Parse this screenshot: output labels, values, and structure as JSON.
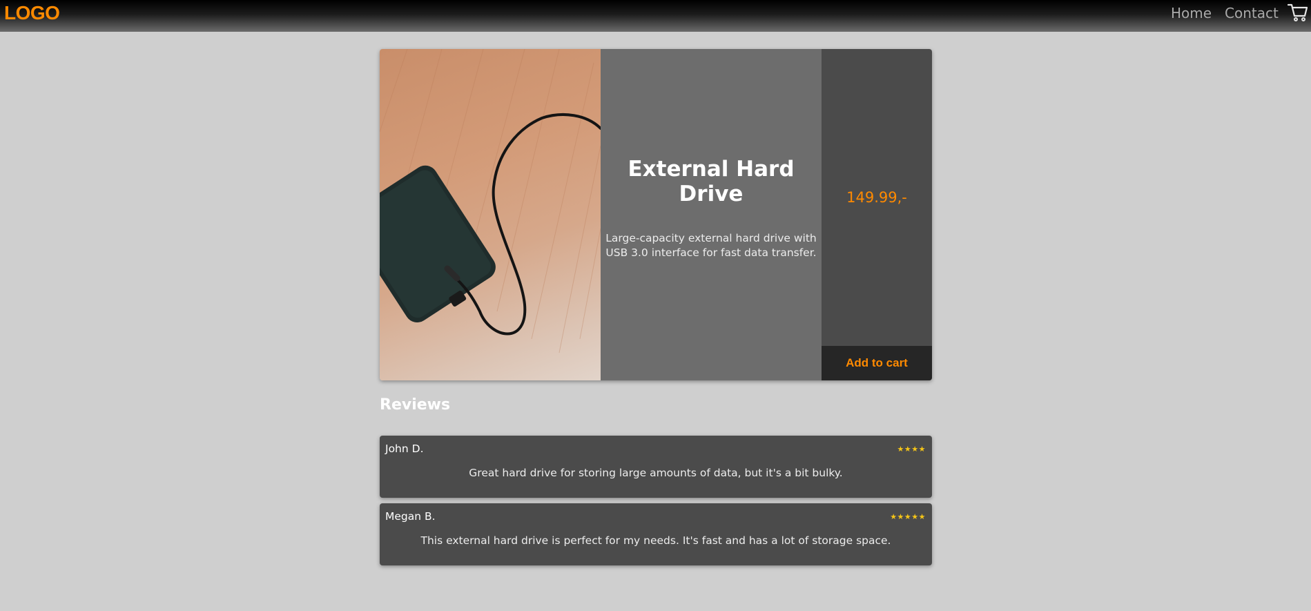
{
  "header": {
    "logo": "LOGO",
    "nav": [
      {
        "label": "Home"
      },
      {
        "label": "Contact"
      }
    ],
    "cart_icon": "shopping-cart-icon"
  },
  "product": {
    "image": "external-hard-drive-photo",
    "title": "External Hard Drive",
    "description": "Large-capacity external hard drive with USB 3.0 interface for fast data transfer.",
    "price": "149.99,-",
    "add_to_cart_label": "Add to cart"
  },
  "reviews": {
    "title": "Reviews",
    "items": [
      {
        "author": "John D.",
        "stars": "★★★★",
        "rating": 4,
        "text": "Great hard drive for storing large amounts of data, but it's a bit bulky."
      },
      {
        "author": "Megan B.",
        "stars": "★★★★★",
        "rating": 5,
        "text": "This external hard drive is perfect for my needs. It's fast and has a lot of storage space."
      }
    ]
  },
  "colors": {
    "accent": "#ff8a00",
    "background": "#cfcfcf",
    "card_dark": "#4b4b4b",
    "card_mid": "#6d6d6d",
    "button": "#262626",
    "star": "#f5c518"
  }
}
